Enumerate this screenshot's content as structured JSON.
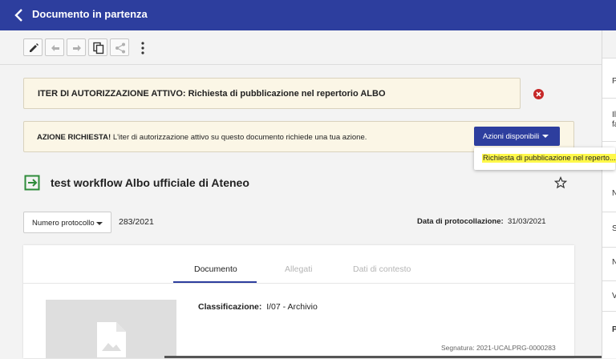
{
  "appbar": {
    "title": "Documento in partenza"
  },
  "toolbar": {
    "buttons": [
      "edit-icon",
      "undo-icon",
      "redo-icon",
      "copy-icon",
      "share-icon"
    ],
    "more": "more-vert-icon"
  },
  "banner_iter": {
    "text": "ITER DI AUTORIZZAZIONE ATTIVO: Richiesta di pubblicazione nel repertorio ALBO"
  },
  "banner_azione": {
    "bold": "AZIONE RICHIESTA!",
    "text": " L'iter di autorizzazione attivo su questo documento richiede una tua azione.",
    "button": "Azioni disponibili",
    "dropdown_item": "Richiesta di pubblicazione nel reperto..."
  },
  "document": {
    "title": "test workflow Albo ufficiale di Ateneo",
    "protocol_select": "Numero protocollo",
    "protocol_number": "283/2021",
    "data_label": "Data di protocollazione:",
    "data_value": "31/03/2021"
  },
  "tabs": [
    {
      "label": "Documento",
      "active": true
    },
    {
      "label": "Allegati",
      "active": false
    },
    {
      "label": "Dati di contesto",
      "active": false
    }
  ],
  "details": {
    "class_label": "Classificazione:",
    "class_value": "I/07 - Archivio",
    "segnatura": "Segnatura: 2021-UCALPRG-0000283"
  },
  "right_panel": {
    "letters": [
      "P",
      "Il",
      "fa",
      "N",
      "S",
      "N",
      "V",
      "P"
    ]
  },
  "colors": {
    "primary": "#2d3e9e",
    "banner_bg": "#fbf6e6",
    "highlight": "#fff84a",
    "close_red": "#c62828",
    "green": "#2e8b3a"
  }
}
